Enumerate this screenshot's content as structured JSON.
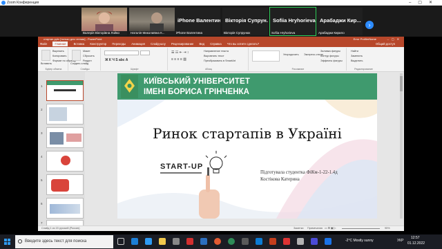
{
  "zoom": {
    "window_title": "Zoom Конференция"
  },
  "participants": [
    {
      "name": "Валерія Вікторівна Лойко",
      "camera": true
    },
    {
      "name": "Наталія Миколаївна К...",
      "camera": true
    },
    {
      "label": "iPhone  Валентина...",
      "name": "iPhone Валентина"
    },
    {
      "label": "Вікторія  Супрун...",
      "name": "Вікторія Супрунюк"
    },
    {
      "label": "Sofiia Hryhorieva",
      "name": "Sofiia Hryhorieva",
      "active": true
    },
    {
      "label": "Арабаджи  Кир...",
      "name": "Арабаджи Кирило"
    }
  ],
  "ppt": {
    "title": "стартап.pptx [только для чтения]  -  PowerPoint",
    "user": "Error ProfilerName",
    "tabs": [
      "Файл",
      "Главная",
      "Вставка",
      "Конструктор",
      "Переходы",
      "Анимация",
      "Слайд-шоу",
      "Рецензирование",
      "Вид",
      "Справка",
      "Что вы хотите сделать?"
    ],
    "share_label": "Общий доступ",
    "ribbon": {
      "paste": "Вставить",
      "cut": "Вырезать",
      "copy": "Копировать",
      "format": "Формат по образцу",
      "clipboard": "Буфер обмена",
      "new_slide": "Создать слайд",
      "layout": "Макет",
      "reset": "Сбросить",
      "section": "Раздел",
      "slides": "Слайды",
      "font": "Шрифт",
      "paragraph": "Абзац",
      "text_dir": "Направление текста",
      "align_text": "Выровнять текст",
      "smartart": "Преобразовать в SmartArt",
      "arrange": "Упорядочить",
      "quick_styles": "Экспресс-стили",
      "fill": "Заливка фигуры",
      "outline": "Контур фигуры",
      "effects": "Эффекты фигуры",
      "drawing": "Рисование",
      "find": "Найти",
      "replace": "Заменить",
      "select": "Выделить",
      "editing": "Редактирование"
    },
    "slide": {
      "uni_line1": "КИЇВСЬКИЙ УНІВЕРСИТЕТ",
      "uni_line2": "ІМЕНІ БОРИСА ГРІНЧЕНКА",
      "title": "Ринок стартапів в Україні",
      "startup": "START-UP",
      "author_line1": "Підготувала студентка ФіКм-1-22-1.4д",
      "author_line2": "Костікова Катерина"
    },
    "thumb_numbers": [
      "1",
      "2",
      "3",
      "4",
      "5",
      "6",
      "7"
    ],
    "status_left": "Слайд 1 из 15    русский (Россия)",
    "status_notes": "Заметки",
    "status_comments": "Примечания",
    "status_zoom": "95%",
    "status_time": "12:57 01.12.2022"
  },
  "taskbar": {
    "search_placeholder": "Введите здесь текст для поиска",
    "weather": "-2°C  Mostly sunny",
    "lang": "УКР",
    "time": "12:57",
    "date": "01.12.2022"
  },
  "colors": {
    "ppt_red": "#b7472a",
    "banner_green": "#3f9a6e",
    "zoom_blue": "#2d8cff"
  }
}
